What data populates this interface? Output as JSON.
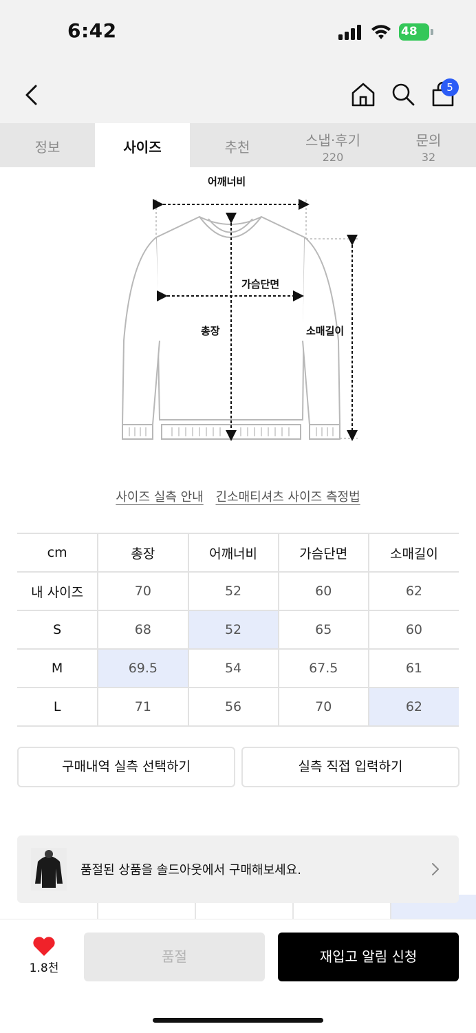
{
  "status": {
    "time": "6:42",
    "battery": "48"
  },
  "nav": {
    "cart_count": "5"
  },
  "tabs": [
    {
      "label": "정보",
      "count": ""
    },
    {
      "label": "사이즈",
      "count": ""
    },
    {
      "label": "추천",
      "count": ""
    },
    {
      "label": "스냅·후기",
      "count": "220"
    },
    {
      "label": "문의",
      "count": "32"
    }
  ],
  "diagram": {
    "shoulder": "어깨너비",
    "chest": "가슴단면",
    "length": "총장",
    "sleeve": "소매길이"
  },
  "links": {
    "guide": "사이즈 실측 안내",
    "measure": "긴소매티셔츠 사이즈 측정법"
  },
  "size_table": {
    "headers": [
      "cm",
      "총장",
      "어깨너비",
      "가슴단면",
      "소매길이"
    ],
    "rows": [
      [
        "내 사이즈",
        "70",
        "52",
        "60",
        "62"
      ],
      [
        "S",
        "68",
        "52",
        "65",
        "60"
      ],
      [
        "M",
        "69.5",
        "54",
        "67.5",
        "61"
      ],
      [
        "L",
        "71",
        "56",
        "70",
        "62"
      ]
    ]
  },
  "buttons": {
    "purchase_history": "구매내역 실측 선택하기",
    "direct_input": "실측 직접 입력하기"
  },
  "banner": {
    "text": "품절된 상품을 솔드아웃에서 구매해보세요."
  },
  "bottom": {
    "like_count": "1.8천",
    "soldout": "품절",
    "restock": "재입고 알림 신청"
  },
  "colors": {
    "accent_blue": "#2b5cf6",
    "highlight": "#e6ecfb",
    "heart": "#f0222a"
  }
}
